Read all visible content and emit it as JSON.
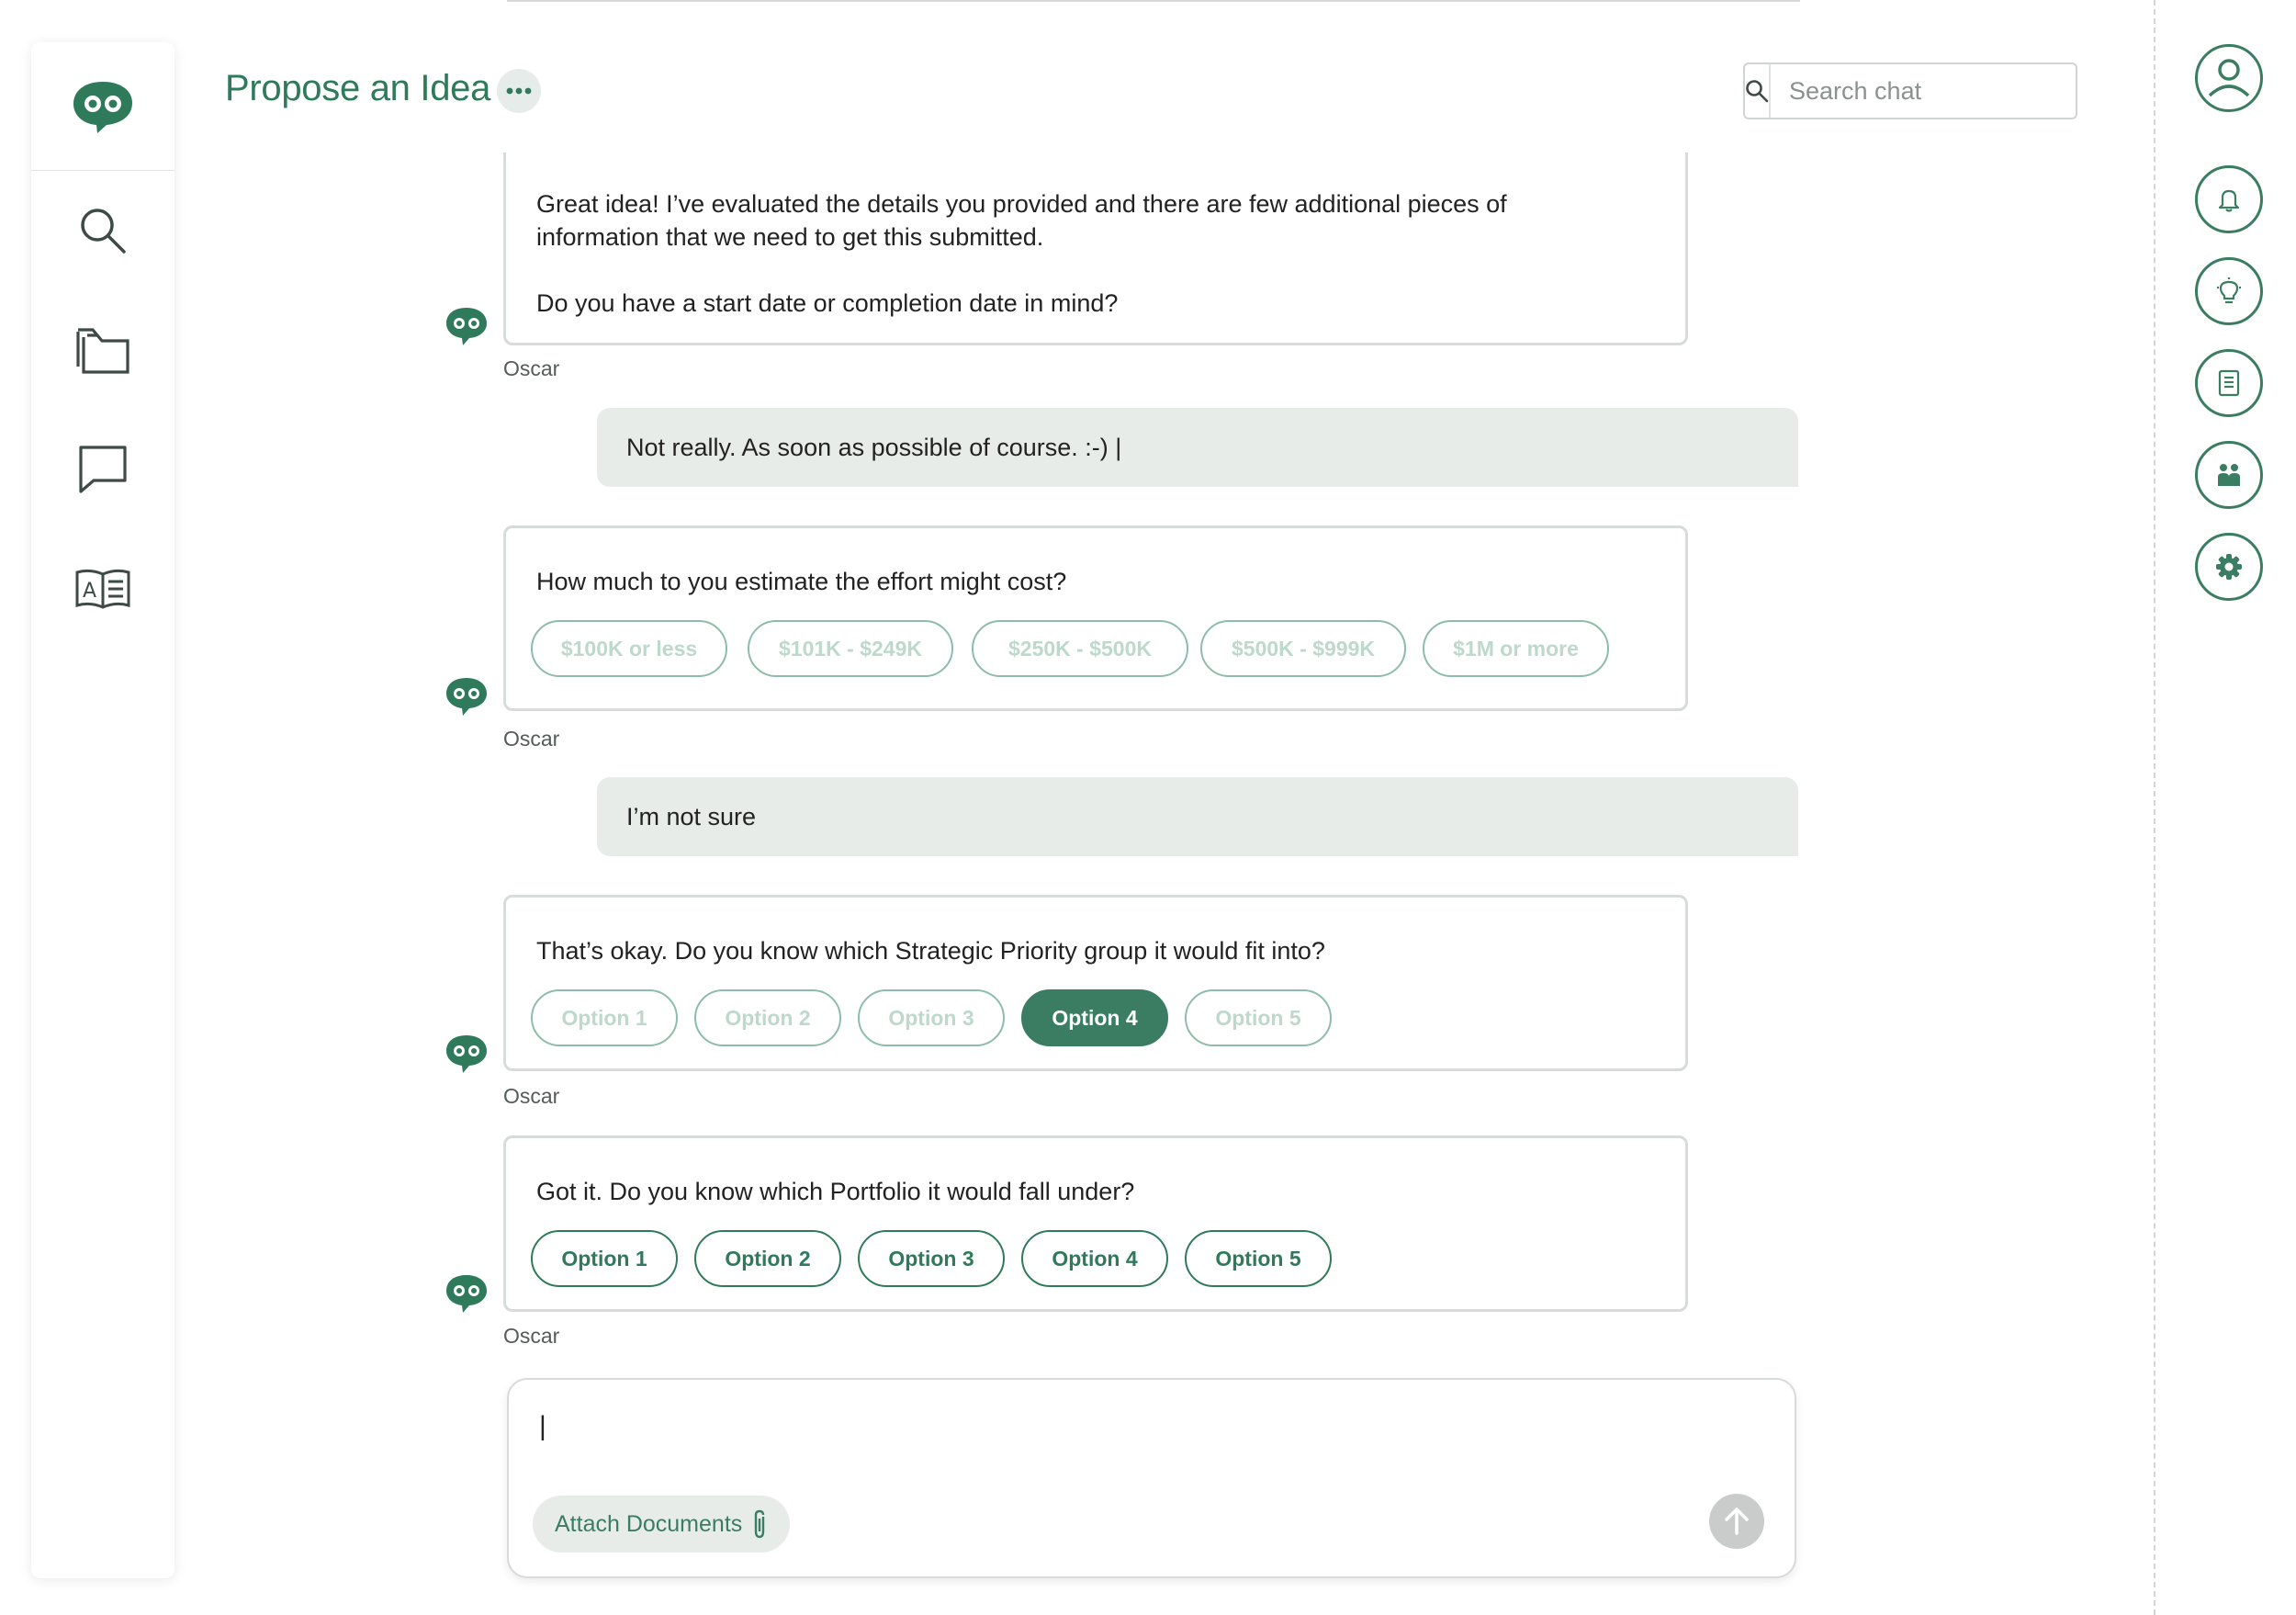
{
  "header": {
    "title": "Propose an Idea",
    "search_placeholder": "Search chat"
  },
  "left_nav": {
    "items": [
      "chat-logo",
      "search",
      "folders",
      "messages",
      "knowledge-base"
    ]
  },
  "right_rail": {
    "items": [
      "profile",
      "notifications",
      "ideas",
      "documents",
      "people",
      "settings"
    ]
  },
  "colors": {
    "brand_green": "#2f7a5b",
    "selected_chip": "#3b7d62",
    "user_bubble": "#e8ece9"
  },
  "conversation": {
    "bot_name": "Oscar",
    "m1": {
      "line1": "Great idea! I’ve evaluated the details you provided and there are few additional pieces of",
      "line2": "information that we need to get this submitted.",
      "line3": "Do you have a start date or completion date in mind?"
    },
    "u1": "Not really. As soon as possible of course. :-) |",
    "m2": {
      "text": "How much to you estimate the effort might cost?",
      "options": [
        "$100K or less",
        "$101K - $249K",
        "$250K - $500K",
        "$500K - $999K",
        "$1M or more"
      ]
    },
    "u2": "I’m not sure",
    "m3": {
      "text": "That’s okay. Do you know which Strategic Priority group it would fit into?",
      "options": [
        "Option 1",
        "Option 2",
        "Option 3",
        "Option 4",
        "Option 5"
      ],
      "selected": "Option 4"
    },
    "m4": {
      "text": "Got it. Do you know which Portfolio it would fall under?",
      "options": [
        "Option 1",
        "Option 2",
        "Option 3",
        "Option 4",
        "Option 5"
      ]
    }
  },
  "composer": {
    "value": "|",
    "attach_label": "Attach Documents"
  }
}
